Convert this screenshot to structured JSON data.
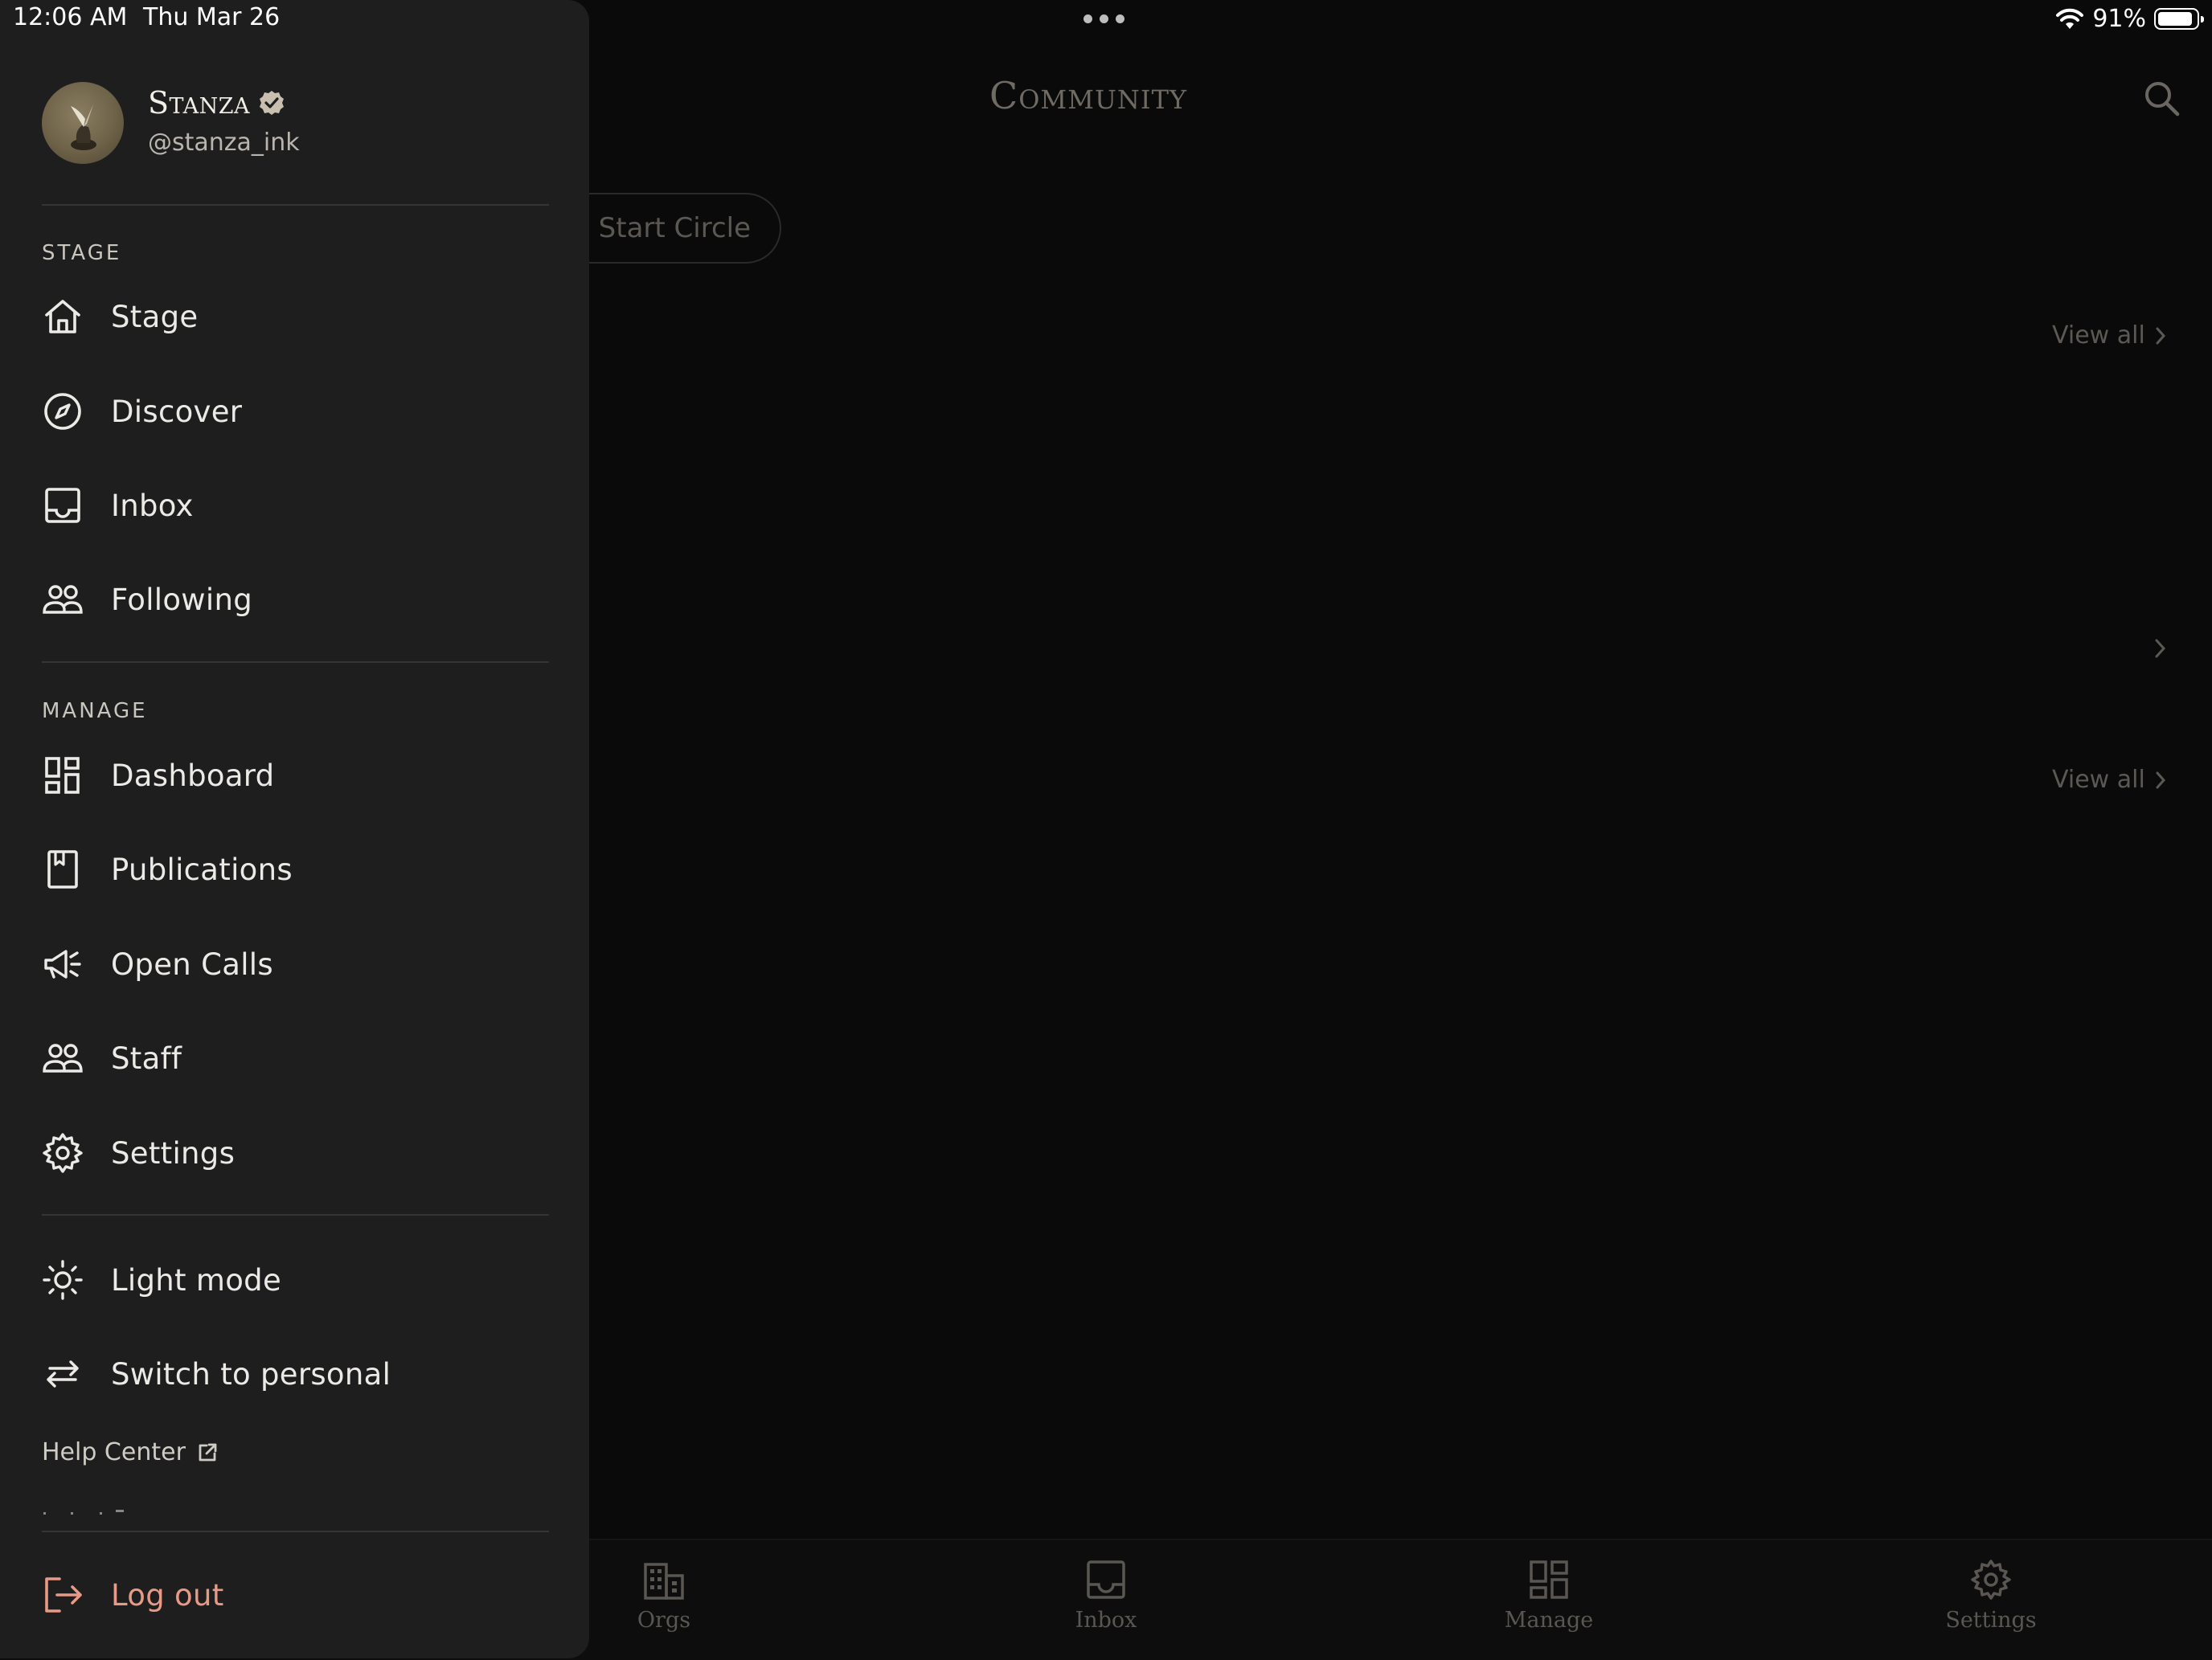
{
  "status_bar": {
    "time": "12:06 AM",
    "date": "Thu Mar 26",
    "battery": "91%",
    "battery_level": 0.91
  },
  "main": {
    "title": "Community",
    "start_circle_label": "Start Circle",
    "view_all_1": "View all",
    "view_all_2": "View all"
  },
  "tab_bar": {
    "tabs": [
      {
        "label": "Orgs",
        "icon": "building-icon"
      },
      {
        "label": "Inbox",
        "icon": "inbox-icon"
      },
      {
        "label": "Manage",
        "icon": "dashboard-icon"
      },
      {
        "label": "Settings",
        "icon": "gear-icon"
      }
    ]
  },
  "drawer": {
    "profile": {
      "name": "Stanza",
      "handle": "@stanza_ink",
      "verified": true
    },
    "stage_section": {
      "label": "STAGE",
      "items": [
        {
          "label": "Stage",
          "icon": "home-icon"
        },
        {
          "label": "Discover",
          "icon": "compass-icon"
        },
        {
          "label": "Inbox",
          "icon": "inbox-icon"
        },
        {
          "label": "Following",
          "icon": "people-icon"
        }
      ]
    },
    "manage_section": {
      "label": "MANAGE",
      "items": [
        {
          "label": "Dashboard",
          "icon": "dashboard-icon"
        },
        {
          "label": "Publications",
          "icon": "book-icon"
        },
        {
          "label": "Open Calls",
          "icon": "megaphone-icon"
        },
        {
          "label": "Staff",
          "icon": "people-icon"
        },
        {
          "label": "Settings",
          "icon": "gear-icon"
        }
      ]
    },
    "preferences": {
      "light_mode": "Light mode",
      "switch_account": "Switch to personal",
      "help_center": "Help Center"
    },
    "logout": "Log out"
  },
  "colors": {
    "drawer_bg": "#1e1e1e",
    "app_bg": "#0a0a0a",
    "logout_accent": "#e79a86",
    "verified_badge": "#c8bfae"
  }
}
